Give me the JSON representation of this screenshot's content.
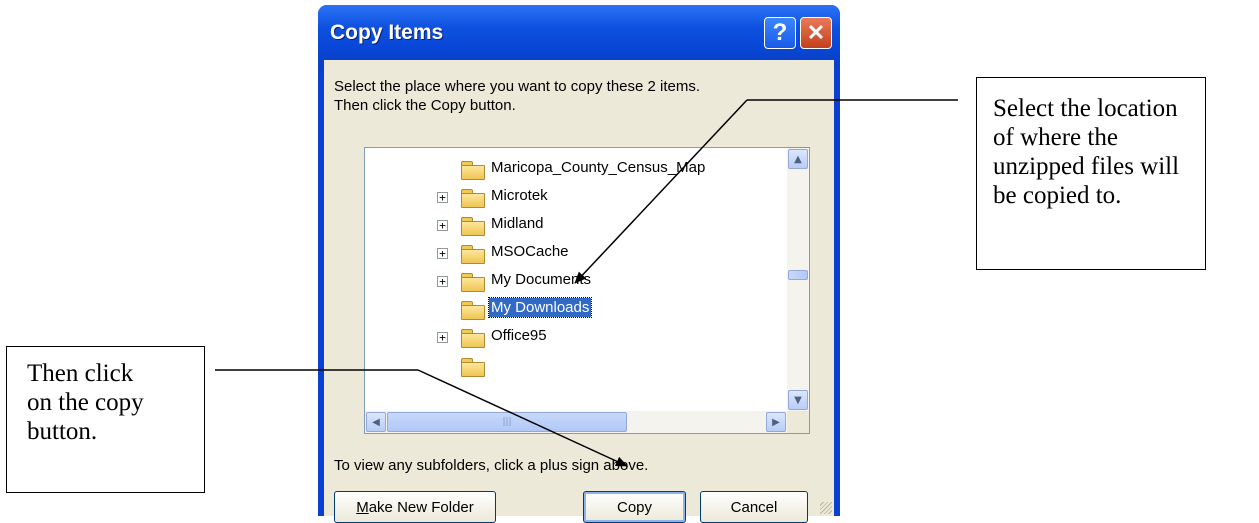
{
  "dialog": {
    "title": "Copy Items",
    "help_label": "?",
    "close_label": "✕",
    "instructions_line1": "Select the place where you want to copy these 2 items.",
    "instructions_line2": "Then click the Copy button.",
    "tree_items": [
      {
        "label": "Maricopa_County_Census_Map",
        "expandable": false,
        "selected": false
      },
      {
        "label": "Microtek",
        "expandable": true,
        "selected": false
      },
      {
        "label": "Midland",
        "expandable": true,
        "selected": false
      },
      {
        "label": "MSOCache",
        "expandable": true,
        "selected": false
      },
      {
        "label": "My Documents",
        "expandable": true,
        "selected": false
      },
      {
        "label": "My Downloads",
        "expandable": false,
        "selected": true
      },
      {
        "label": "Office95",
        "expandable": true,
        "selected": false
      }
    ],
    "hint": "To view any subfolders, click a plus sign above.",
    "buttons": {
      "make_new_folder_prefix": "M",
      "make_new_folder_rest": "ake New Folder",
      "copy": "Copy",
      "cancel": "Cancel"
    }
  },
  "callouts": {
    "right": "Select the location\nof where the\nunzipped files will\nbe copied to.",
    "left": "Then click\non the copy\nbutton."
  }
}
